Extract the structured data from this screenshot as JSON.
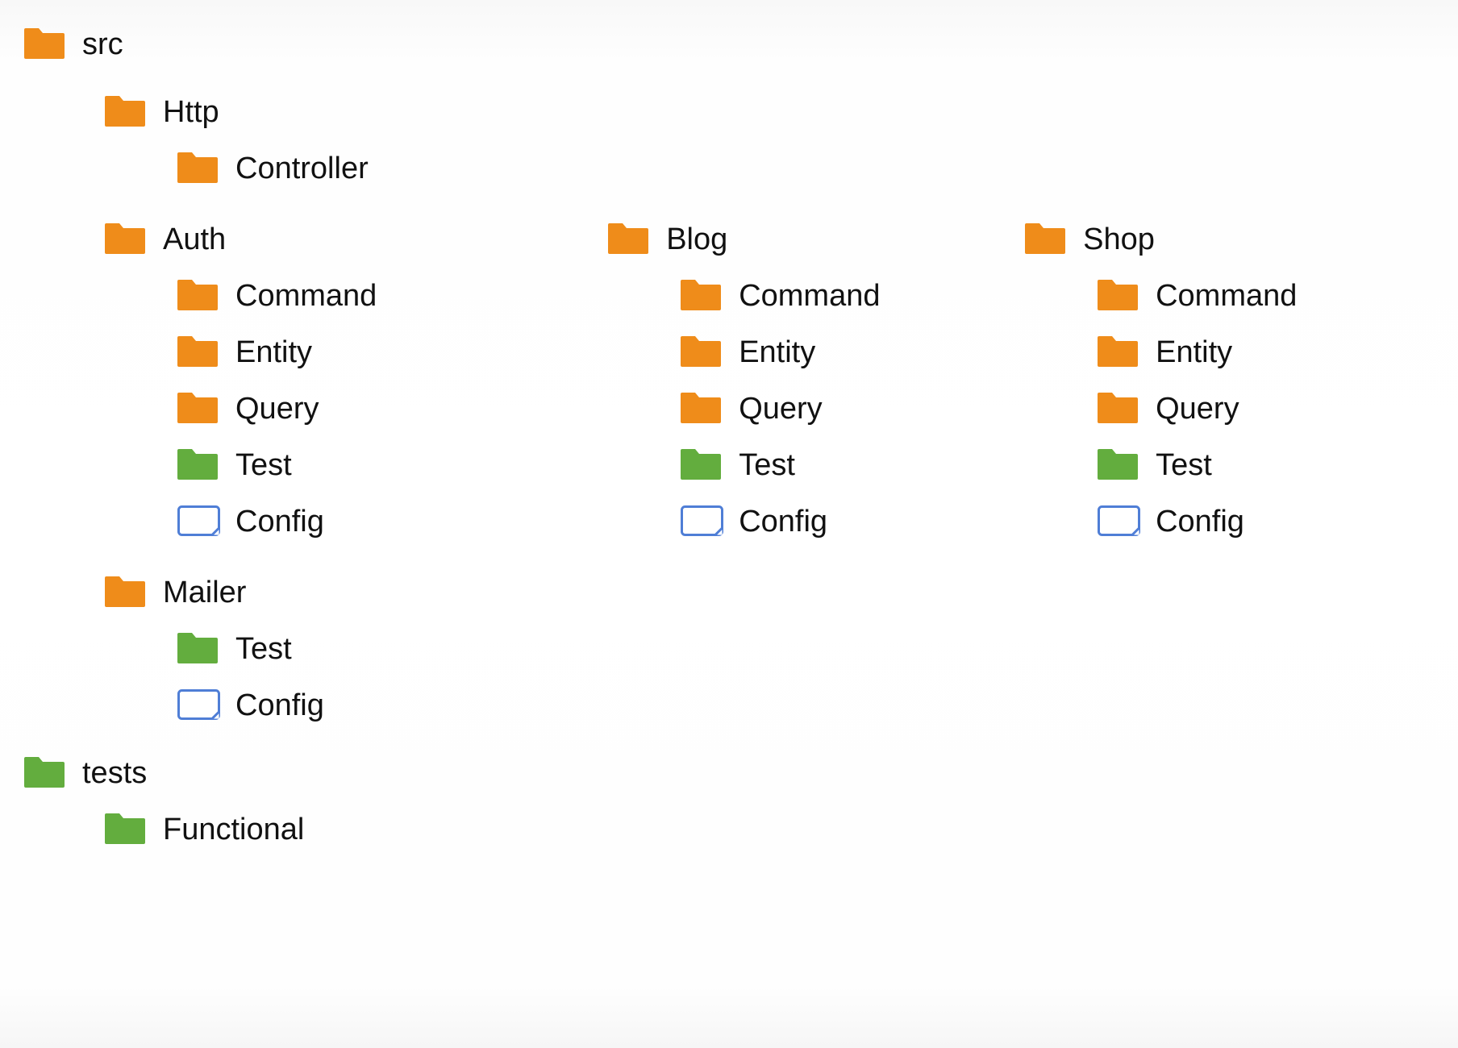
{
  "tree": {
    "src": {
      "label": "src",
      "http": {
        "label": "Http",
        "controller": {
          "label": "Controller"
        }
      },
      "auth": {
        "label": "Auth",
        "command": {
          "label": "Command"
        },
        "entity": {
          "label": "Entity"
        },
        "query": {
          "label": "Query"
        },
        "test": {
          "label": "Test"
        },
        "config": {
          "label": "Config"
        }
      },
      "blog": {
        "label": "Blog",
        "command": {
          "label": "Command"
        },
        "entity": {
          "label": "Entity"
        },
        "query": {
          "label": "Query"
        },
        "test": {
          "label": "Test"
        },
        "config": {
          "label": "Config"
        }
      },
      "shop": {
        "label": "Shop",
        "command": {
          "label": "Command"
        },
        "entity": {
          "label": "Entity"
        },
        "query": {
          "label": "Query"
        },
        "test": {
          "label": "Test"
        },
        "config": {
          "label": "Config"
        }
      },
      "mailer": {
        "label": "Mailer",
        "test": {
          "label": "Test"
        },
        "config": {
          "label": "Config"
        }
      }
    },
    "tests": {
      "label": "tests",
      "functional": {
        "label": "Functional"
      }
    }
  },
  "colors": {
    "folder_orange": "#ef8c1a",
    "folder_green": "#63ad3e",
    "file_blue": "#4f7ed6"
  }
}
